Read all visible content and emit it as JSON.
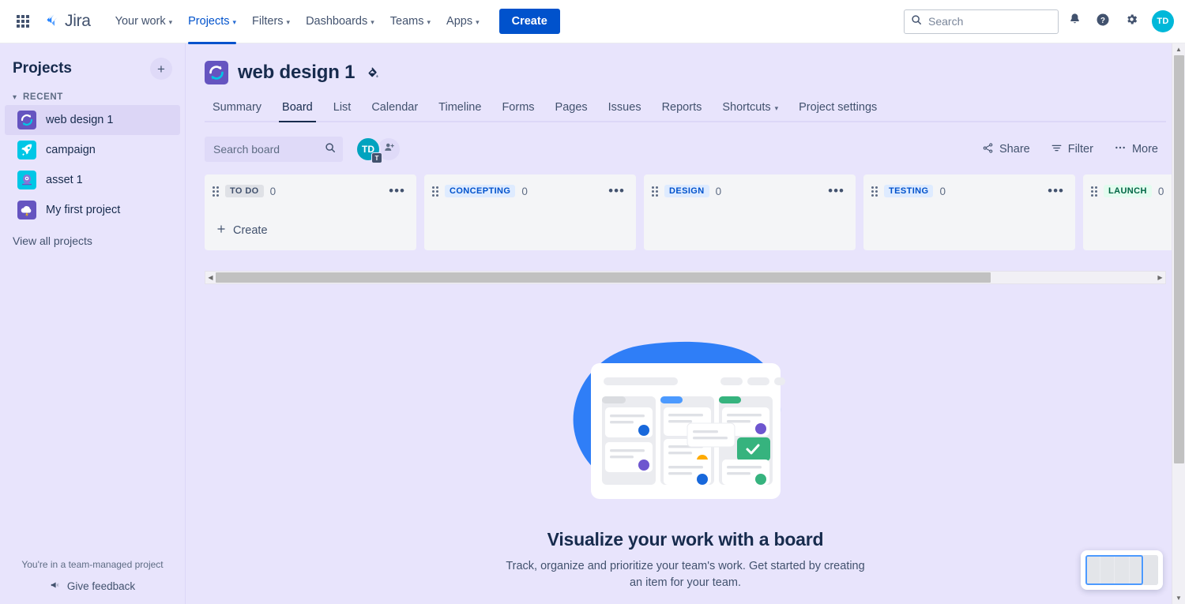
{
  "topnav": {
    "apps_grid_icon": "grid-icon",
    "brand": "Jira",
    "items": [
      {
        "label": "Your work",
        "has_caret": true,
        "active": false
      },
      {
        "label": "Projects",
        "has_caret": true,
        "active": true
      },
      {
        "label": "Filters",
        "has_caret": true,
        "active": false
      },
      {
        "label": "Dashboards",
        "has_caret": true,
        "active": false
      },
      {
        "label": "Teams",
        "has_caret": true,
        "active": false
      },
      {
        "label": "Apps",
        "has_caret": true,
        "active": false
      }
    ],
    "create_label": "Create",
    "search_placeholder": "Search",
    "search_value": "",
    "notifications_icon": "bell-icon",
    "help_icon": "help-circle-icon",
    "settings_icon": "gear-icon",
    "avatar_initials": "TD",
    "avatar_color": "#00B8D9"
  },
  "sidebar": {
    "title": "Projects",
    "add_label": "+",
    "section_label": "RECENT",
    "items": [
      {
        "label": "web design 1",
        "selected": true,
        "icon": "project-icon-refresh",
        "bg": "#6554C0"
      },
      {
        "label": "campaign",
        "selected": false,
        "icon": "project-icon-rocket",
        "bg": "#00C7E6"
      },
      {
        "label": "asset 1",
        "selected": false,
        "icon": "project-icon-alien",
        "bg": "#00C7E6"
      },
      {
        "label": "My first project",
        "selected": false,
        "icon": "project-icon-cloud",
        "bg": "#6554C0"
      }
    ],
    "view_all": "View all projects",
    "footer_note": "You're in a team-managed project",
    "feedback_label": "Give feedback",
    "feedback_icon": "megaphone-icon"
  },
  "project": {
    "name": "web design 1",
    "icon": "project-icon-refresh",
    "paint_icon": "paint-bucket-icon",
    "tabs": [
      {
        "label": "Summary",
        "active": false,
        "has_caret": false
      },
      {
        "label": "Board",
        "active": true,
        "has_caret": false
      },
      {
        "label": "List",
        "active": false,
        "has_caret": false
      },
      {
        "label": "Calendar",
        "active": false,
        "has_caret": false
      },
      {
        "label": "Timeline",
        "active": false,
        "has_caret": false
      },
      {
        "label": "Forms",
        "active": false,
        "has_caret": false
      },
      {
        "label": "Pages",
        "active": false,
        "has_caret": false
      },
      {
        "label": "Issues",
        "active": false,
        "has_caret": false
      },
      {
        "label": "Reports",
        "active": false,
        "has_caret": false
      },
      {
        "label": "Shortcuts",
        "active": false,
        "has_caret": true
      },
      {
        "label": "Project settings",
        "active": false,
        "has_caret": false
      }
    ]
  },
  "board_toolbar": {
    "search_placeholder": "Search board",
    "search_value": "",
    "search_icon": "search-icon",
    "member_avatar": {
      "initials": "TD",
      "badge": "T",
      "color": "#00A3BF"
    },
    "add_people_icon": "add-person-icon",
    "actions": [
      {
        "label": "Share",
        "icon": "share-icon"
      },
      {
        "label": "Filter",
        "icon": "filter-icon"
      },
      {
        "label": "More",
        "icon": "more-horizontal-icon"
      }
    ]
  },
  "board": {
    "create_label": "Create",
    "columns": [
      {
        "name": "TO DO",
        "count": "0",
        "badge_bg": "#DFE1E6",
        "badge_fg": "#42526E",
        "show_create": true,
        "partial": false
      },
      {
        "name": "CONCEPTING",
        "count": "0",
        "badge_bg": "#DEEBFF",
        "badge_fg": "#0052CC",
        "show_create": false,
        "partial": false
      },
      {
        "name": "DESIGN",
        "count": "0",
        "badge_bg": "#DEEBFF",
        "badge_fg": "#0052CC",
        "show_create": false,
        "partial": false
      },
      {
        "name": "TESTING",
        "count": "0",
        "badge_bg": "#DEEBFF",
        "badge_fg": "#0052CC",
        "show_create": false,
        "partial": false
      },
      {
        "name": "LAUNCH",
        "count": "0",
        "badge_bg": "#E3FCEF",
        "badge_fg": "#006644",
        "show_create": false,
        "partial": true
      }
    ],
    "column_menu_icon": "more-horizontal-icon",
    "drag_handle_icon": "drag-handle-icon"
  },
  "empty_state": {
    "illustration": "board-illustration",
    "title": "Visualize your work with a board",
    "subtitle": "Track, organize and prioritize your team's work. Get started by creating an item for your team."
  },
  "minimap": {
    "name": "board-minimap",
    "columns": 5,
    "viewport_percent": 79
  },
  "scrollbars": {
    "horizontal": {
      "thumb_percent": 82.5,
      "left_arrow": "chevron-left-icon",
      "right_arrow": "chevron-right-icon"
    },
    "vertical": {
      "thumb_percent": 76,
      "up_arrow": "chevron-up-icon",
      "down_arrow": "chevron-down-icon"
    }
  },
  "colors": {
    "brand_blue": "#0052CC",
    "page_bg": "#E8E4FC",
    "column_bg": "#F4F5F7",
    "text": "#172B4D",
    "subtle_text": "#42526E"
  }
}
